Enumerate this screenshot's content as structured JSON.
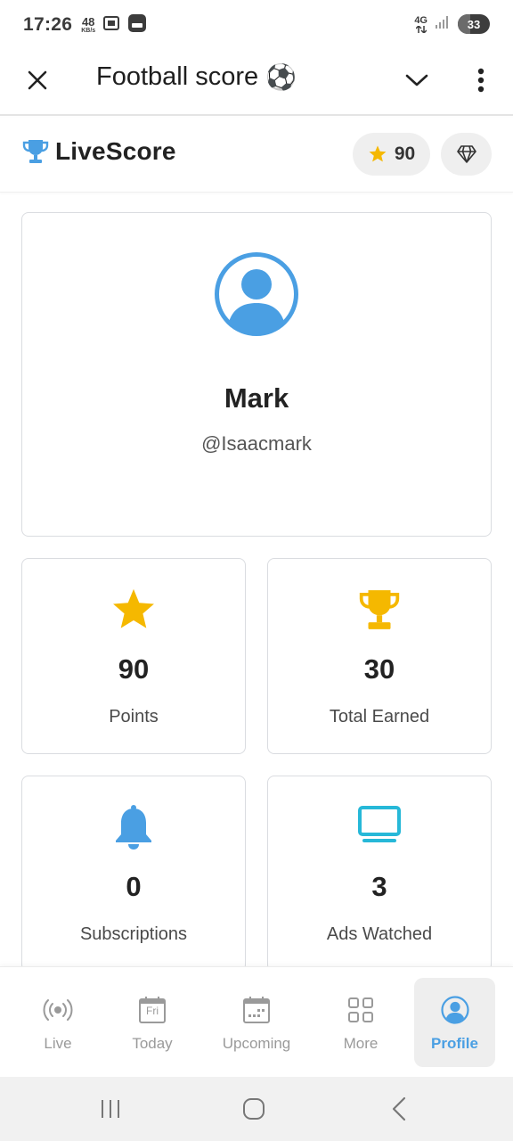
{
  "status_bar": {
    "time": "17:26",
    "net_speed": "48",
    "net_unit": "KB/s",
    "network": "4G",
    "battery": "33"
  },
  "app_bar": {
    "title": "Football score",
    "title_emoji": "⚽"
  },
  "header": {
    "brand": "LiveScore",
    "points": "90"
  },
  "profile": {
    "name": "Mark",
    "handle": "@Isaacmark"
  },
  "stats": [
    {
      "value": "90",
      "label": "Points",
      "icon": "star-icon"
    },
    {
      "value": "30",
      "label": "Total Earned",
      "icon": "trophy-icon"
    },
    {
      "value": "0",
      "label": "Subscriptions",
      "icon": "bell-icon"
    },
    {
      "value": "3",
      "label": "Ads Watched",
      "icon": "tv-icon"
    }
  ],
  "bottom_nav": [
    {
      "label": "Live",
      "icon": "live-broadcast-icon",
      "active": false
    },
    {
      "label": "Today",
      "icon": "calendar-today-icon",
      "calendar_text": "Fri",
      "active": false
    },
    {
      "label": "Upcoming",
      "icon": "calendar-upcoming-icon",
      "active": false
    },
    {
      "label": "More",
      "icon": "grid-icon",
      "active": false
    },
    {
      "label": "Profile",
      "icon": "profile-icon",
      "active": true
    }
  ],
  "colors": {
    "accent_blue": "#4a9fe3",
    "gold": "#f5b800",
    "cyan": "#26b8d8",
    "inactive_gray": "#9a9a9a"
  }
}
